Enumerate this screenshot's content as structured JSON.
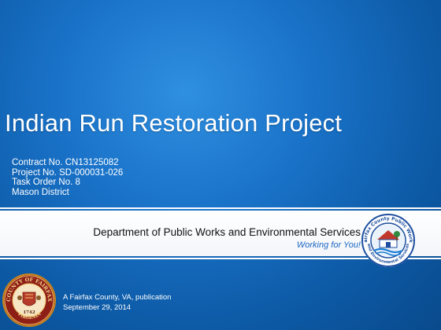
{
  "slide": {
    "title": "Indian Run Restoration Project",
    "details": [
      "Contract No. CN13125082",
      "Project No. SD-000031-026",
      "Task Order No. 8",
      "Mason District"
    ],
    "department": "Department of Public Works and Environmental Services",
    "tagline": "Working for You!",
    "logo": {
      "icon": "dpwes-logo-icon",
      "ring_top_text": "Fairfax County Public Works",
      "ring_bottom_text": "and Environmental Services"
    },
    "seal": {
      "icon": "county-seal-icon",
      "ring_top_text": "COUNTY OF FAIRFAX",
      "ring_bottom_text": "VIRGINIA",
      "year": "1742"
    },
    "publication": "A Fairfax County, VA, publication",
    "date": "September 29, 2014"
  },
  "colors": {
    "background": "#1a73c9",
    "tagline": "#1a66c2",
    "logo_ring": "#1e4fa0",
    "seal_ring": "#c8851c"
  }
}
